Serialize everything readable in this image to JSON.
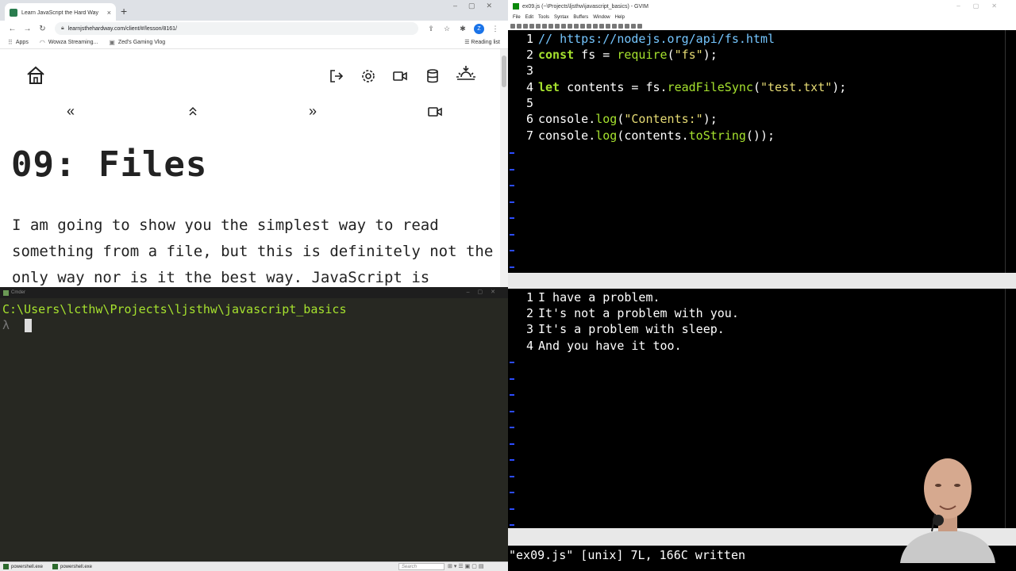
{
  "browser": {
    "tab_title": "Learn JavaScript the Hard Way",
    "tab_close": "×",
    "new_tab": "+",
    "url": "learnjsthehardway.com/client/#/lesson/8161/",
    "bookmarks": [
      {
        "label": "Apps",
        "icon": "apps-grid-icon"
      },
      {
        "label": "Wowza Streaming...",
        "icon": "wowza-icon"
      },
      {
        "label": "Zed's Gaming Vlog",
        "icon": "bookmark-favicon"
      }
    ],
    "reading_list": "Reading list",
    "profile_letter": "Z",
    "nav": {
      "prev": "«",
      "up": "⌃",
      "next": "»"
    },
    "lesson_title": "09: Files",
    "lesson_body": "I am going to show you the simplest way to read something from a file, but this is definitely not the only way nor is it the best way. JavaScript is"
  },
  "terminal": {
    "window_title": "Cmder",
    "path": "C:\\Users\\lcthw\\Projects\\ljsthw\\javascript_basics",
    "prompt": "λ"
  },
  "taskbar": {
    "items": [
      "powershell.exe",
      "powershell.exe"
    ],
    "search_placeholder": "Search"
  },
  "vim": {
    "window_title": "ex09.js (~\\Projects\\ljsthw\\javascript_basics) - GVIM",
    "menu": [
      "File",
      "Edit",
      "Tools",
      "Syntax",
      "Buffers",
      "Window",
      "Help"
    ],
    "code_lines": [
      {
        "n": "1",
        "text": "// https://nodejs.org/api/fs.html"
      },
      {
        "n": "2",
        "text": "const fs = require(\"fs\");"
      },
      {
        "n": "3",
        "text": ""
      },
      {
        "n": "4",
        "text": "let contents = fs.readFileSync(\"test.txt\");"
      },
      {
        "n": "5",
        "text": ""
      },
      {
        "n": "6",
        "text": "console.log(\"Contents:\");"
      },
      {
        "n": "7",
        "text": "console.log(contents.toString());"
      }
    ],
    "text_lines": [
      {
        "n": "1",
        "text": "I have a problem."
      },
      {
        "n": "2",
        "text": "It's not a problem with you."
      },
      {
        "n": "3",
        "text": "It's a problem with sleep."
      },
      {
        "n": "4",
        "text": "And you have it too."
      }
    ],
    "cmdline": "\"ex09.js\" [unix] 7L, 166C written"
  },
  "colors": {
    "terminal_bg": "#272822",
    "terminal_path": "#a6e22e",
    "vim_keyword": "#a6e22e",
    "vim_string": "#e6db74",
    "vim_comment": "#75c6ff",
    "vim_tilde": "#2b4bff"
  }
}
